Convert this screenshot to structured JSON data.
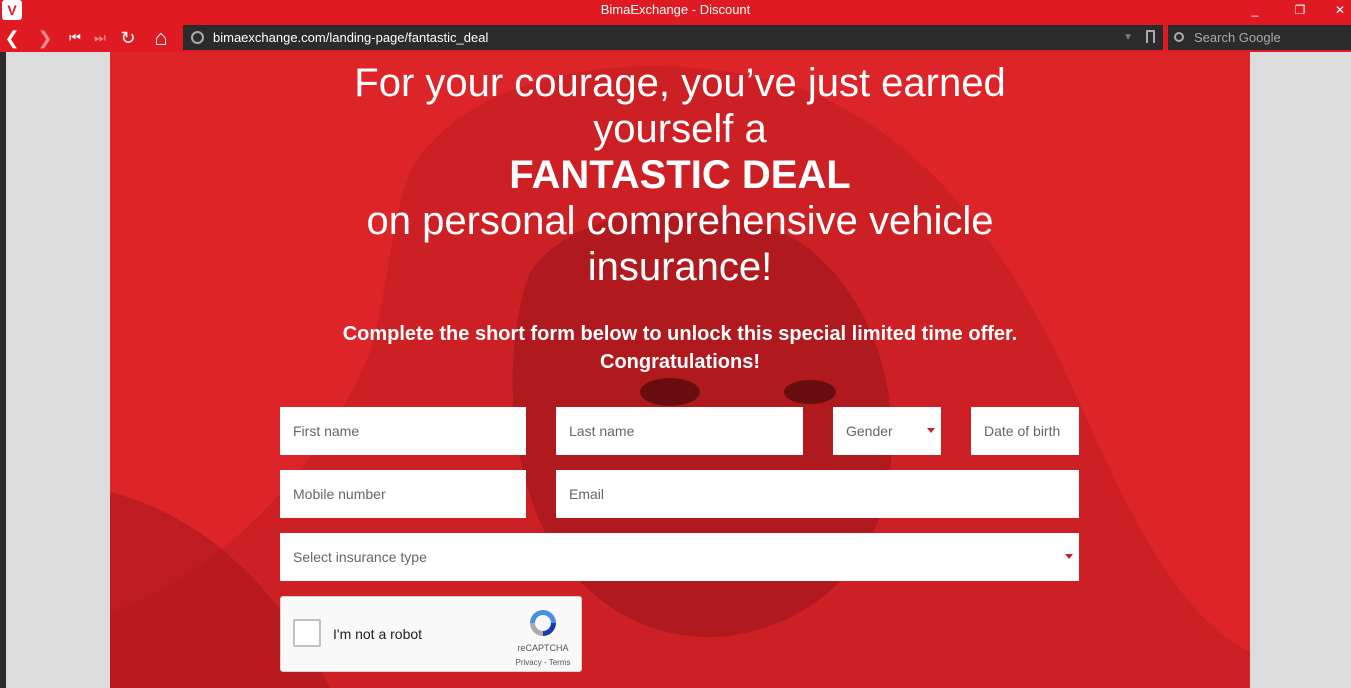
{
  "window": {
    "title": "BimaExchange - Discount",
    "logo_letter": "V",
    "min_icon": "_",
    "max_icon": "❐",
    "close_icon": "✕"
  },
  "nav": {
    "back": "❮",
    "forward": "❯",
    "rewind": "⏮",
    "fastforward": "⏭",
    "reload": "↻",
    "home": "⌂",
    "url": "bimaexchange.com/landing-page/fantastic_deal",
    "search_placeholder": "Search Google"
  },
  "hero": {
    "line1": "For your courage, you’ve just earned",
    "line2": "yourself a",
    "line3": "FANTASTIC DEAL",
    "line4": "on personal comprehensive vehicle",
    "line5": "insurance!"
  },
  "subtitle": {
    "line1": "Complete the short form below to unlock this special limited time offer.",
    "line2": "Congratulations!"
  },
  "form": {
    "first_name": "First name",
    "last_name": "Last name",
    "gender": "Gender",
    "dob": "Date of birth",
    "mobile": "Mobile number",
    "email": "Email",
    "insurance_type": "Select insurance type"
  },
  "captcha": {
    "label": "I'm not a robot",
    "brand": "reCAPTCHA",
    "terms": "Privacy - Terms"
  },
  "colors": {
    "brand_red": "#e01a22",
    "page_red": "#dd2429"
  }
}
